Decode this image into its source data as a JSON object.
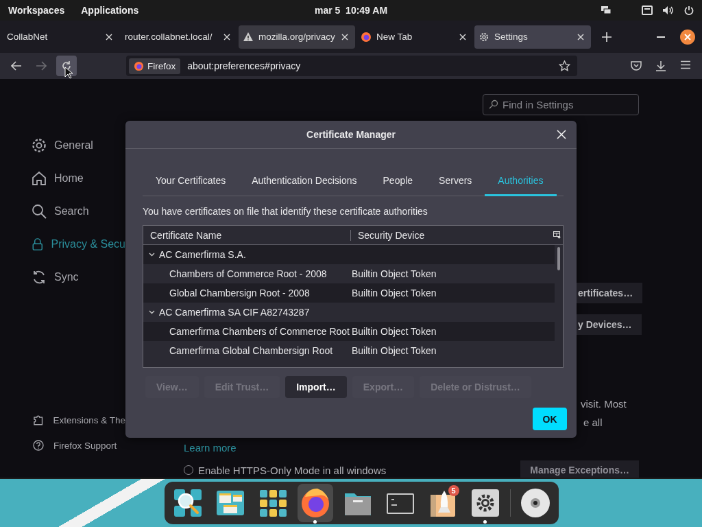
{
  "top_bar": {
    "left": [
      "Workspaces",
      "Applications"
    ],
    "clock": "mar 5  10:49 AM"
  },
  "tabs": [
    {
      "title": "CollabNet",
      "kind": "plain",
      "selected": false,
      "hovered": false
    },
    {
      "title": "router.collabnet.local/",
      "kind": "plain",
      "selected": false,
      "hovered": false
    },
    {
      "title": "mozilla.org/privacy",
      "kind": "warning",
      "selected": false,
      "hovered": true
    },
    {
      "title": "New Tab",
      "kind": "firefox",
      "selected": false,
      "hovered": false
    },
    {
      "title": "Settings",
      "kind": "gear",
      "selected": true,
      "hovered": false
    }
  ],
  "nav": {
    "forward_disabled": true,
    "identity": "Firefox",
    "url": "about:preferences#privacy"
  },
  "sidebar": {
    "items": [
      {
        "label": "General",
        "kind": "gear",
        "selected": false
      },
      {
        "label": "Home",
        "kind": "home",
        "selected": false
      },
      {
        "label": "Search",
        "kind": "search",
        "selected": false
      },
      {
        "label": "Privacy & Secu",
        "kind": "lock",
        "selected": true
      },
      {
        "label": "Sync",
        "kind": "sync",
        "selected": false
      }
    ],
    "footer": [
      {
        "label": "Extensions & The",
        "kind": "puzzle"
      },
      {
        "label": "Firefox Support",
        "kind": "help"
      }
    ]
  },
  "search": {
    "placeholder": "Find in Settings"
  },
  "page_fragments": {
    "buttons": [
      "ertificates…",
      "y Devices…"
    ],
    "text_lines": [
      "visit. Most",
      "e all"
    ],
    "link": "Learn more",
    "radio": {
      "label": "Enable HTTPS-Only Mode in all windows",
      "checked": false
    },
    "exceptions_button": "Manage Exceptions…"
  },
  "dialog": {
    "title": "Certificate Manager",
    "tabs": [
      {
        "label": "Your Certificates",
        "selected": false
      },
      {
        "label": "Authentication Decisions",
        "selected": false
      },
      {
        "label": "People",
        "selected": false
      },
      {
        "label": "Servers",
        "selected": false
      },
      {
        "label": "Authorities",
        "selected": true
      }
    ],
    "description": "You have certificates on file that identify these certificate authorities",
    "columns": [
      "Certificate Name",
      "Security Device"
    ],
    "rows": [
      {
        "name": "AC Camerfirma S.A.",
        "expanded": true,
        "children": [
          {
            "name": "Chambers of Commerce Root - 2008",
            "device": "Builtin Object Token"
          },
          {
            "name": "Global Chambersign Root - 2008",
            "device": "Builtin Object Token"
          }
        ]
      },
      {
        "name": "AC Camerfirma SA CIF A82743287",
        "expanded": true,
        "children": [
          {
            "name": "Camerfirma Chambers of Commerce Root",
            "device": "Builtin Object Token"
          },
          {
            "name": "Camerfirma Global Chambersign Root",
            "device": "Builtin Object Token"
          }
        ]
      }
    ],
    "buttons": [
      {
        "label": "View…",
        "disabled": true
      },
      {
        "label": "Edit Trust…",
        "disabled": true
      },
      {
        "label": "Import…",
        "disabled": false
      },
      {
        "label": "Export…",
        "disabled": true
      },
      {
        "label": "Delete or Distrust…",
        "disabled": true
      }
    ],
    "ok": "OK"
  },
  "dock": {
    "items": [
      {
        "kind": "search",
        "selected": false,
        "running": false
      },
      {
        "kind": "windows",
        "selected": false,
        "running": false
      },
      {
        "kind": "grid",
        "selected": false,
        "running": false
      },
      {
        "kind": "firefox",
        "selected": true,
        "running": true
      },
      {
        "kind": "folder",
        "selected": false,
        "running": false
      },
      {
        "kind": "terminal",
        "selected": false,
        "running": false
      },
      {
        "kind": "store",
        "selected": false,
        "running": false,
        "badge": "5"
      },
      {
        "kind": "settings",
        "selected": false,
        "running": true
      }
    ],
    "pinned": [
      {
        "kind": "disc",
        "selected": false,
        "running": false
      }
    ]
  }
}
